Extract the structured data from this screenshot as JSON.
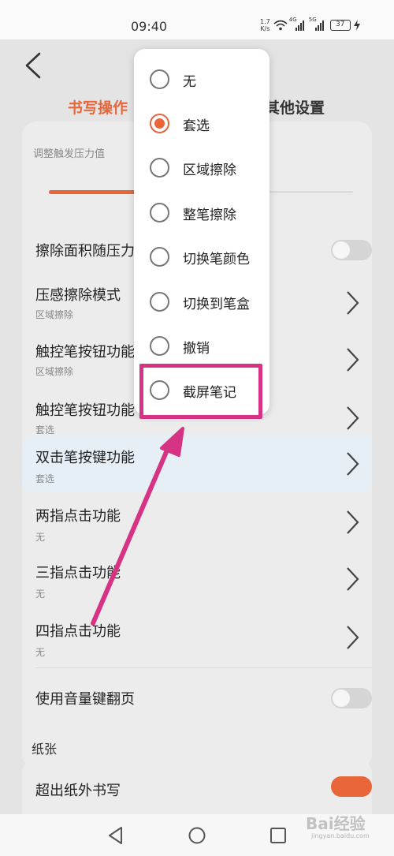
{
  "status_bar": {
    "time": "09:40",
    "net_speed_value": "1.7",
    "net_speed_unit": "K/s",
    "signal1_label": "4G",
    "signal2_label": "5G",
    "battery": "37"
  },
  "header": {
    "tab_writing": "书写操作",
    "tab_other": "其他设置"
  },
  "pressure": {
    "label": "调整触发压力值",
    "level": 0.32
  },
  "settings": {
    "erase_area_pressure": {
      "title": "擦除面积随压力"
    },
    "pressure_erase_mode": {
      "title": "压感擦除模式",
      "value": "区域擦除"
    },
    "stylus_button_1": {
      "title": "触控笔按钮功能",
      "value": "区域擦除"
    },
    "stylus_button_2": {
      "title": "触控笔按钮功能",
      "value": "套选"
    },
    "double_tap_pen_key": {
      "title": "双击笔按键功能",
      "value": "套选"
    },
    "two_finger_tap": {
      "title": "两指点击功能",
      "value": "无"
    },
    "three_finger_tap": {
      "title": "三指点击功能",
      "value": "无"
    },
    "four_finger_tap": {
      "title": "四指点击功能",
      "value": "无"
    },
    "volume_page_turn": {
      "title": "使用音量键翻页"
    }
  },
  "paper": {
    "label": "纸张",
    "partial_row_title": "超出纸外书写"
  },
  "popup": {
    "options": [
      {
        "label": "无",
        "selected": false
      },
      {
        "label": "套选",
        "selected": true
      },
      {
        "label": "区域擦除",
        "selected": false
      },
      {
        "label": "整笔擦除",
        "selected": false
      },
      {
        "label": "切换笔颜色",
        "selected": false
      },
      {
        "label": "切换到笔盒",
        "selected": false
      },
      {
        "label": "撤销",
        "selected": false
      },
      {
        "label": "截屏笔记",
        "selected": false
      }
    ]
  },
  "watermark": {
    "text": "Bai经验",
    "sub": "jingyan.baidu.com"
  },
  "colors": {
    "accent": "#e8663a",
    "annotation": "#d63384"
  },
  "icons": {
    "back": "back-chevron-icon",
    "chevron": "chevron-right-icon",
    "nav_back": "triangle-back-icon",
    "nav_home": "circle-home-icon",
    "nav_recent": "square-recent-icon"
  }
}
